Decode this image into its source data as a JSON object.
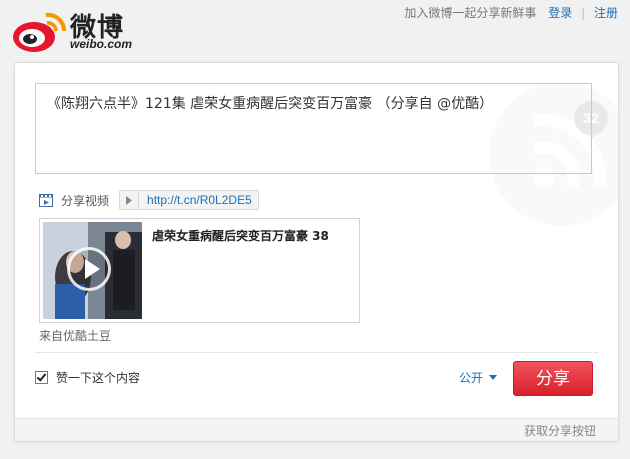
{
  "header": {
    "logo_word": "微博",
    "logo_sub": "weibo.com",
    "tagline": "加入微博一起分享新鲜事",
    "login_label": "登录",
    "signup_label": "注册"
  },
  "composer": {
    "char_count": "32",
    "text": "《陈翔六点半》121集 虐荣女重病醒后突变百万富豪 （分享自 @优酷）",
    "share_video_label": "分享视频",
    "short_url": "http://t.cn/R0L2DE5"
  },
  "preview": {
    "title": "虐荣女重病醒后突变百万富豪 38",
    "source": "来自优酷土豆"
  },
  "actions": {
    "like_label": "赞一下这个内容",
    "like_checked": true,
    "visibility_label": "公开",
    "share_button": "分享"
  },
  "footer": {
    "get_button_label": "获取分享按钮"
  },
  "colors": {
    "accent_red": "#e0242e",
    "link_blue": "#1f6fb7"
  }
}
